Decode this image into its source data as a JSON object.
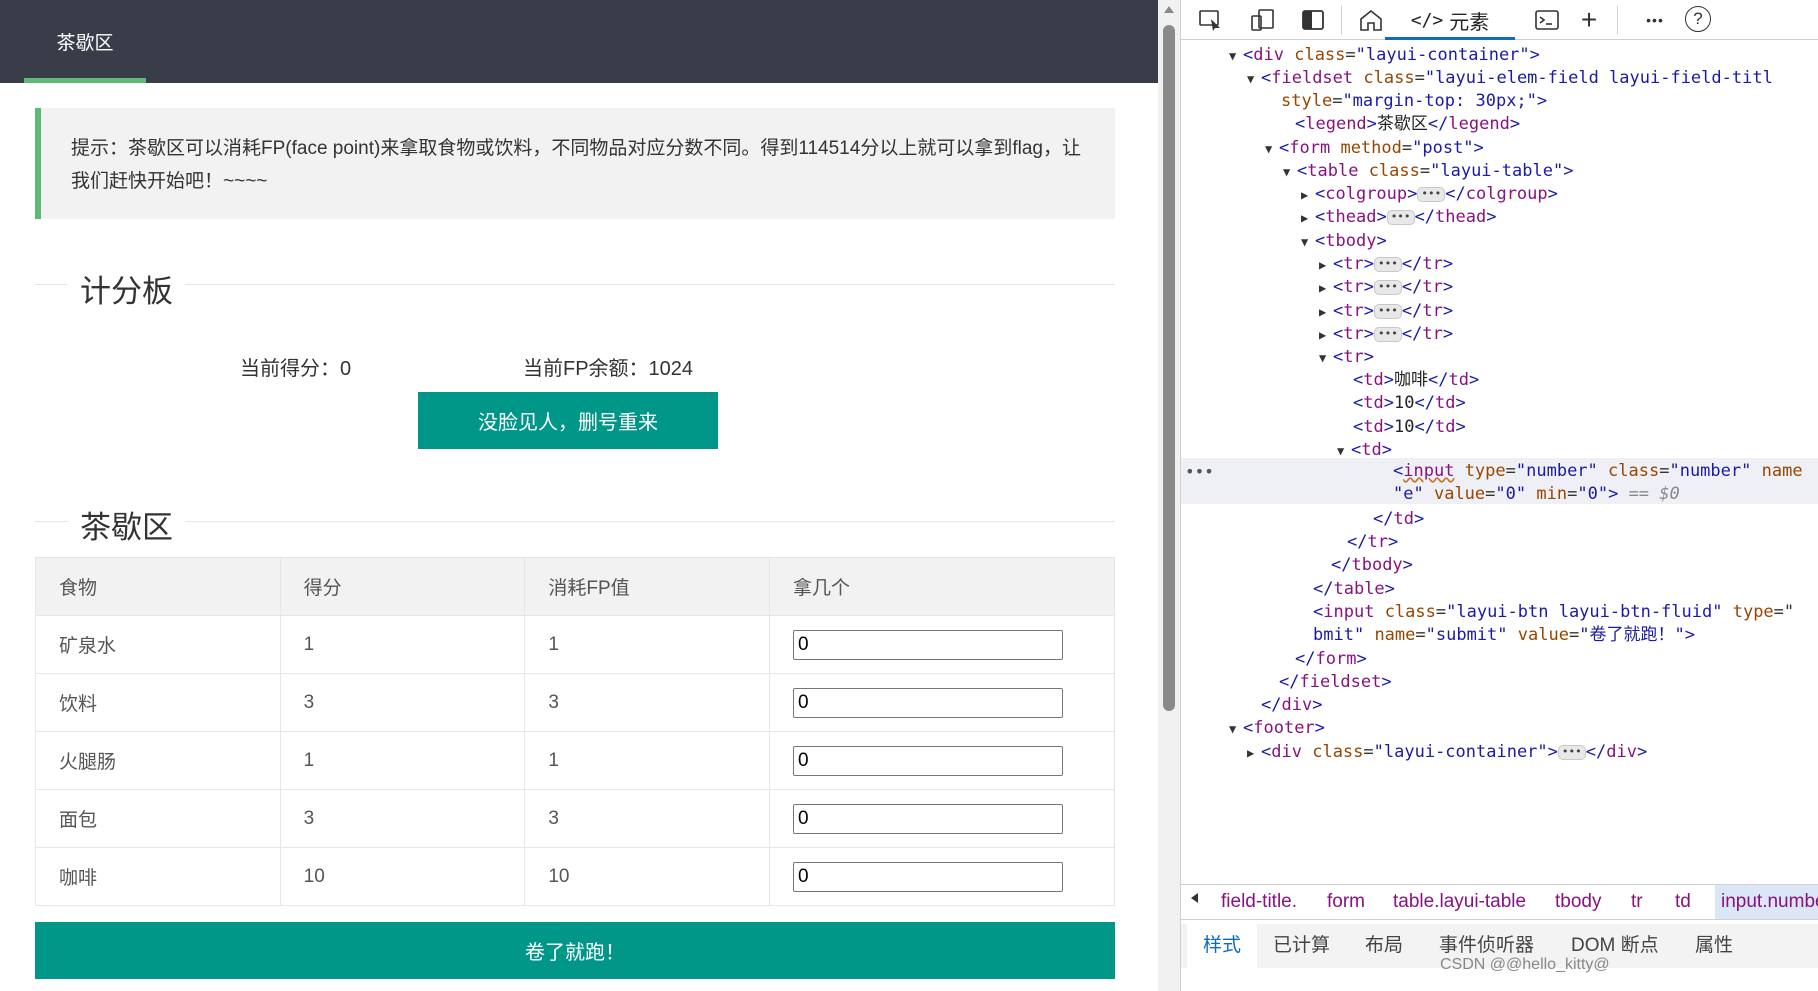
{
  "nav": {
    "active_item": "茶歇区"
  },
  "tip": {
    "text": "提示：茶歇区可以消耗FP(face point)来拿取食物或饮料，不同物品对应分数不同。得到114514分以上就可以拿到flag，让我们赶快开始吧！~~~~"
  },
  "scoreboard": {
    "legend": "计分板",
    "score_label": "当前得分：0",
    "fp_label": "当前FP余额：1024",
    "reset_button": "没脸见人，删号重来"
  },
  "teabreak": {
    "legend": "茶歇区",
    "columns": [
      "食物",
      "得分",
      "消耗FP值",
      "拿几个"
    ],
    "rows": [
      {
        "food": "矿泉水",
        "score": "1",
        "fp": "1",
        "qty": "0"
      },
      {
        "food": "饮料",
        "score": "3",
        "fp": "3",
        "qty": "0"
      },
      {
        "food": "火腿肠",
        "score": "1",
        "fp": "1",
        "qty": "0"
      },
      {
        "food": "面包",
        "score": "3",
        "fp": "3",
        "qty": "0"
      },
      {
        "food": "咖啡",
        "score": "10",
        "fp": "10",
        "qty": "0"
      }
    ],
    "submit_button": "卷了就跑！"
  },
  "devtools": {
    "toolbar": {
      "icons": [
        "inspect-icon",
        "device-icon",
        "dock-icon",
        "home-icon",
        "elements-icon",
        "console-icon",
        "add-icon",
        "more-icon",
        "help-icon"
      ],
      "active_tab": "元素",
      "add_symbol": "+",
      "more_symbol": "•••",
      "help_symbol": "?"
    },
    "dom": {
      "l1_tag": "div",
      "l1_attr": "class",
      "l1_val": "\"layui-container\"",
      "l2_tag": "fieldset",
      "l2_attr": "class",
      "l2_val": "\"layui-elem-field layui-field-titl",
      "l3_attr": "style",
      "l3_val": "\"margin-top: 30px;\"",
      "l4_tag": "legend",
      "l4_text": "茶歇区",
      "l5_tag": "form",
      "l5_attr": "method",
      "l5_val": "\"post\"",
      "l6_tag": "table",
      "l6_attr": "class",
      "l6_val": "\"layui-table\"",
      "l7_tag": "colgroup",
      "l8_tag": "thead",
      "l9_tag": "tbody",
      "tr_tag": "tr",
      "td_tag": "td",
      "td1_text": "咖啡",
      "td2_text": "10",
      "td3_text": "10",
      "input_tag": "input",
      "input_type_attr": "type",
      "input_type_val": "\"number\"",
      "input_class_attr": "class",
      "input_class_val": "\"number\"",
      "input_name_attr": "name",
      "input_name_val": "\"e\"",
      "input_value_attr": "value",
      "input_value_val": "\"0\"",
      "input_min_attr": "min",
      "input_min_val": "\"0\"",
      "eq0": "== $0",
      "submit_class_attr": "class",
      "submit_class_val": "\"layui-btn layui-btn-fluid\"",
      "submit_type_attr": "type",
      "submit_type_cont": "bmit\"",
      "submit_name_attr": "name",
      "submit_name_val": "\"submit\"",
      "submit_value_attr": "value",
      "submit_value_val": "\"卷了就跑！\"",
      "footer_tag": "footer",
      "footer_div_attr": "class",
      "footer_div_val": "\"layui-container\"",
      "ellipsis": "•••"
    },
    "breadcrumb": [
      "field-title.",
      "form",
      "table.layui-table",
      "tbody",
      "tr",
      "td",
      "input.numbe"
    ],
    "subtabs": [
      "样式",
      "已计算",
      "布局",
      "事件侦听器",
      "DOM 断点",
      "属性"
    ]
  },
  "watermark": "CSDN @@hello_kitty@"
}
